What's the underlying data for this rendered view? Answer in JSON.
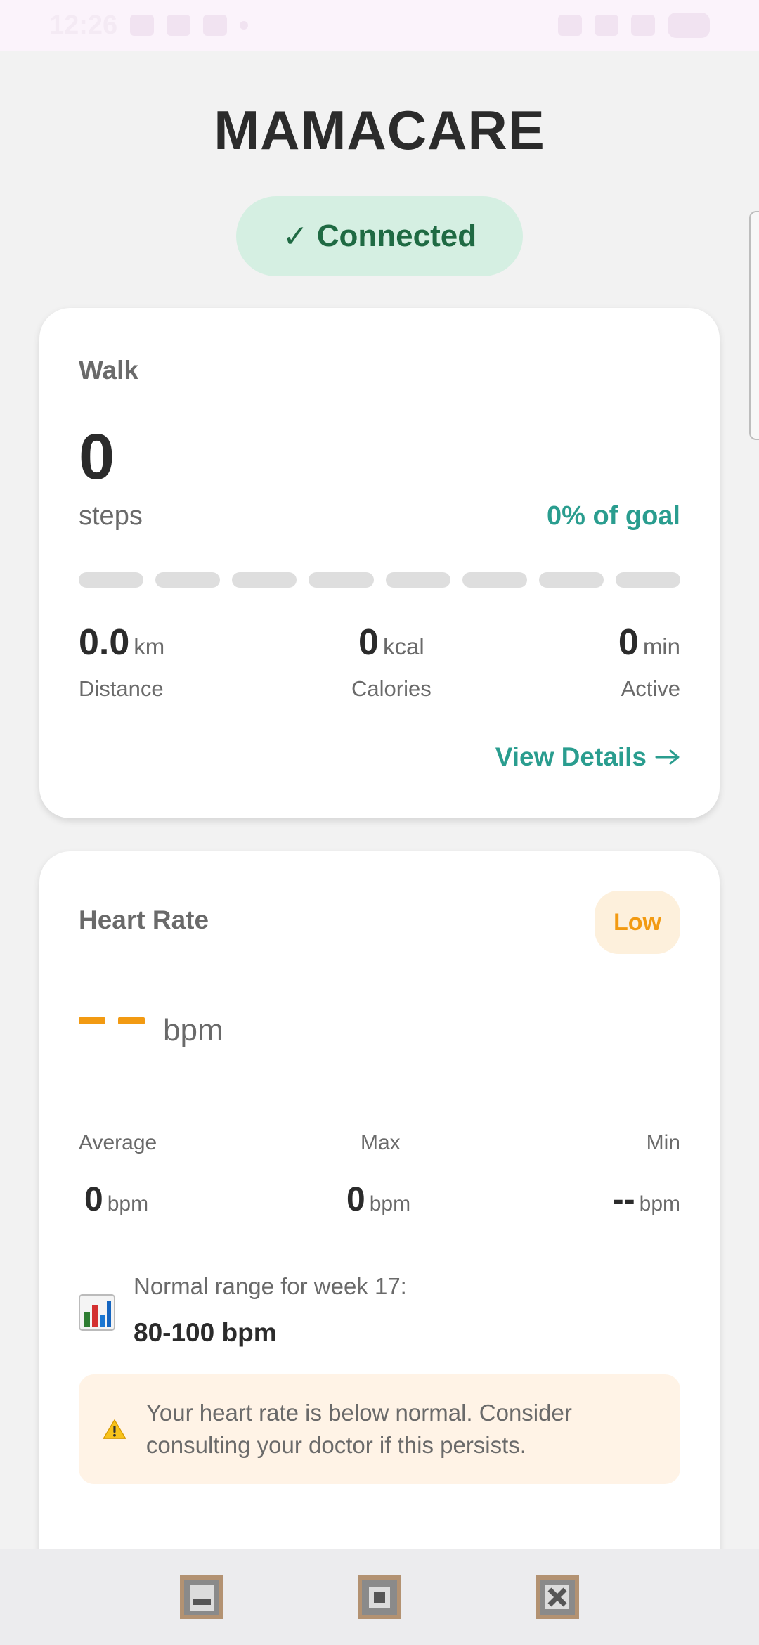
{
  "status_bar": {
    "time": "12:26",
    "left_icons": [
      "sim-icon",
      "chat-icon",
      "mail-icon",
      "dot-icon"
    ],
    "right_icons": [
      "lte-icon",
      "mute-icon",
      "signal-icon",
      "battery-icon"
    ],
    "battery": "61"
  },
  "header": {
    "title": "MAMACARE",
    "connection": {
      "icon": "check-icon",
      "label": "Connected"
    }
  },
  "walk": {
    "label": "Walk",
    "steps": "0",
    "steps_unit": "steps",
    "goal_text": "0% of goal",
    "progress_fraction": 0.0,
    "segments": 8,
    "metrics": [
      {
        "value": "0.0",
        "unit": "km",
        "label": "Distance"
      },
      {
        "value": "0",
        "unit": "kcal",
        "label": "Calories"
      },
      {
        "value": "0",
        "unit": "min",
        "label": "Active"
      }
    ],
    "view_details": "View Details",
    "view_details_icon": "arrow-right-icon"
  },
  "heart": {
    "label": "Heart Rate",
    "status": "Low",
    "current_unit": "bpm",
    "stats": [
      {
        "label": "Average",
        "value": "0",
        "unit": "bpm"
      },
      {
        "label": "Max",
        "value": "0",
        "unit": "bpm"
      },
      {
        "label": "Min",
        "value": "--",
        "unit": "bpm"
      }
    ],
    "range_caption": "Normal range for week 17:",
    "range_value": "80-100 bpm",
    "range_icon": "bar-chart-icon",
    "warning_icon": "warning-icon",
    "warning_text": "Your heart rate is below normal. Consider consulting your doctor if this persists."
  },
  "colors": {
    "accent": "#2a9d8f",
    "connected_bg": "#d5efe2",
    "connected_text": "#1f6a43",
    "warning": "#f29a12",
    "warning_bg": "#fff3e6"
  },
  "nav": [
    "nav-recent-icon",
    "nav-home-icon",
    "nav-back-icon"
  ]
}
